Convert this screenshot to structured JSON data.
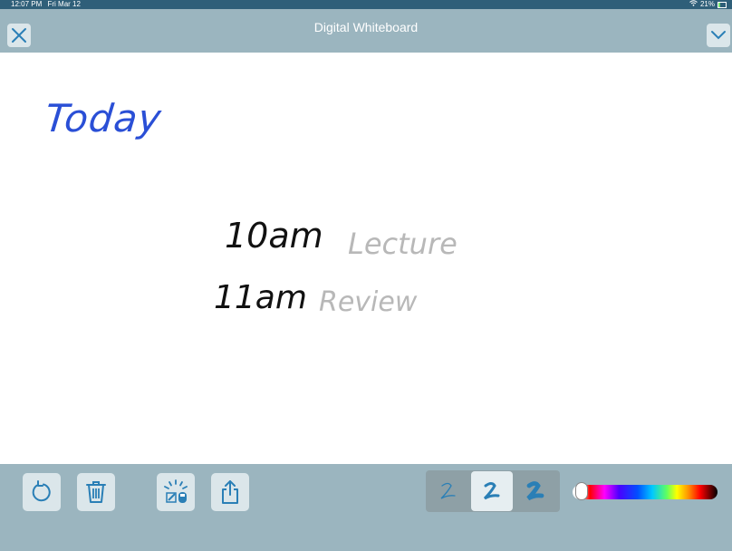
{
  "status_bar": {
    "time": "12:07 PM",
    "date": "Fri Mar 12",
    "battery_percent": "21%",
    "battery_level": 0.21
  },
  "nav": {
    "title": "Digital Whiteboard"
  },
  "canvas": {
    "strokes": [
      {
        "text": "Today",
        "color": "#2a4fd6"
      },
      {
        "text": "10am",
        "color": "#111111"
      },
      {
        "text": "Lecture",
        "color": "#b8b8b8"
      },
      {
        "text": "11am",
        "color": "#111111"
      },
      {
        "text": "Review",
        "color": "#b8b8b8"
      }
    ]
  },
  "toolbar": {
    "tools": [
      "undo-icon",
      "trash-icon",
      "clear-canvas-icon",
      "share-icon"
    ],
    "pen_sizes": [
      "thin",
      "medium",
      "thick"
    ],
    "selected_pen": "medium",
    "color_slider_position": 0.02,
    "accent_color": "#2a7fb6"
  }
}
